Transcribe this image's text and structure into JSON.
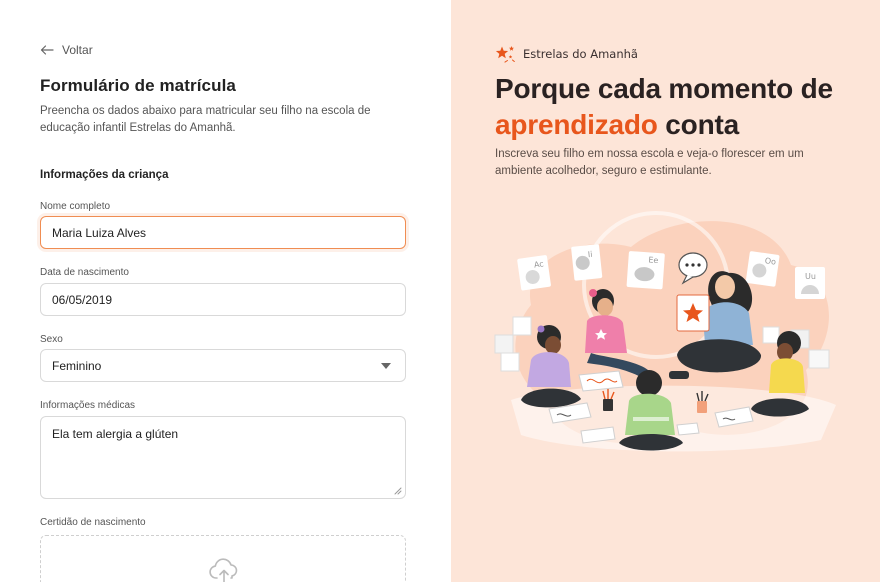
{
  "back": {
    "label": "Voltar"
  },
  "form": {
    "title": "Formulário de matrícula",
    "description": "Preencha os dados abaixo para matricular seu filho na escola de educação infantil Estrelas do Amanhã.",
    "section_title": "Informações da criança",
    "fields": {
      "name": {
        "label": "Nome completo",
        "value": "Maria Luiza Alves"
      },
      "birthdate": {
        "label": "Data de nascimento",
        "value": "06/05/2019"
      },
      "sex": {
        "label": "Sexo",
        "value": "Feminino"
      },
      "medical": {
        "label": "Informações médicas",
        "value": "Ela tem alergia a glúten"
      },
      "certificate": {
        "label": "Certidão de nascimento"
      }
    }
  },
  "promo": {
    "brand_name": "Estrelas do Amanhã",
    "headline_part1": "Porque cada momento de ",
    "headline_accent": "aprendizado",
    "headline_part2": " conta",
    "subtitle": "Inscreva seu filho em nossa escola e veja-o florescer em um ambiente acolhedor, seguro e estimulante.",
    "card_letters": [
      "Ac",
      "Ee",
      "Uu",
      "Ii",
      "Oo"
    ]
  },
  "colors": {
    "accent": "#e8561c",
    "focus_border": "#f08d52",
    "promo_background": "#fde5d8"
  },
  "icons": {
    "back": "arrow-left-icon",
    "brand": "stars-logo-icon",
    "select": "caret-down-icon",
    "upload": "cloud-upload-icon"
  }
}
